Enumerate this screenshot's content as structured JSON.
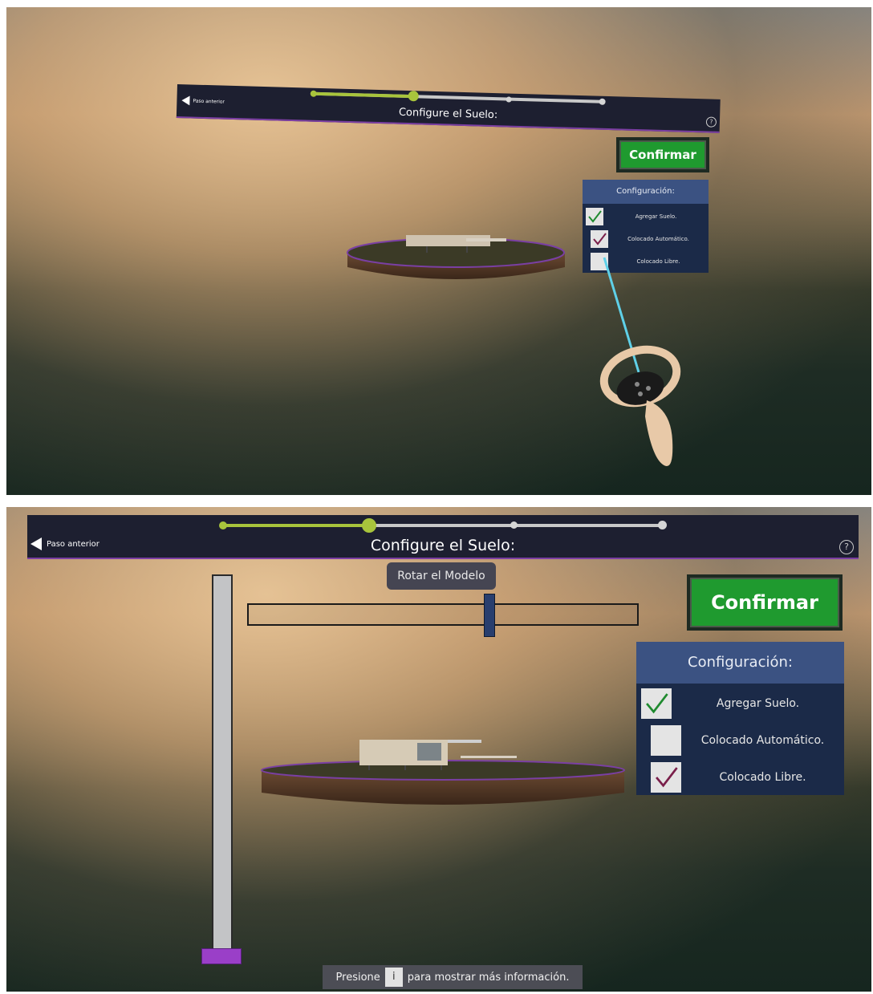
{
  "step_bar": {
    "back_label": "Paso anterior",
    "title": "Configure el Suelo:",
    "help_icon": "?",
    "steps_total": 4,
    "current_step": 2
  },
  "confirm_label": "Confirmar",
  "config_panel": {
    "title": "Configuración:",
    "options": [
      {
        "label": "Agregar Suelo."
      },
      {
        "label": "Colocado Automático."
      },
      {
        "label": "Colocado Libre."
      }
    ]
  },
  "screen1_checked": [
    true,
    true,
    false
  ],
  "screen2_checked": [
    true,
    false,
    true
  ],
  "colors": {
    "accent_green": "#a8c43c",
    "confirm_green": "#1f9a2f",
    "panel_blue": "#1b2a48",
    "panel_header": "#3b5282",
    "check_green": "#1f8a2f",
    "check_purple": "#7a1f4a",
    "handle_purple": "#9a3fc8"
  },
  "rotate_slider": {
    "label": "Rotar el Modelo",
    "value": 0.62
  },
  "vertical_slider": {
    "value": 0.0
  },
  "hint": {
    "before": "Presione",
    "key": "i",
    "after": "para mostrar más información."
  }
}
